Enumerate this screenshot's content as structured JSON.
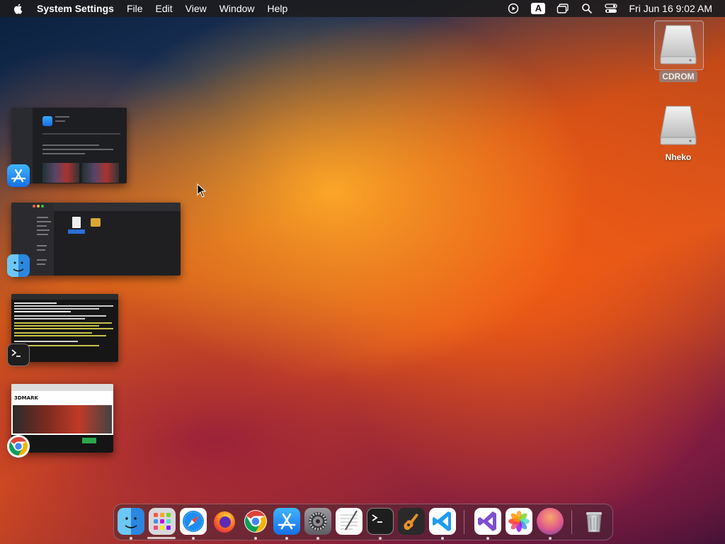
{
  "menubar": {
    "app_name": "System Settings",
    "menus": [
      "File",
      "Edit",
      "View",
      "Window",
      "Help"
    ],
    "clock": "Fri Jun 16  9:02 AM",
    "input_badge": "A"
  },
  "desktop": {
    "icons": [
      {
        "label": "CDROM",
        "selected": true
      },
      {
        "label": "Nheko",
        "selected": false
      }
    ]
  },
  "expose": {
    "windows": [
      {
        "app": "App Store",
        "icon": "app-store-icon"
      },
      {
        "app": "Finder",
        "icon": "finder-icon"
      },
      {
        "app": "Terminal",
        "icon": "terminal-icon"
      },
      {
        "app": "Google Chrome",
        "icon": "chrome-icon",
        "page_logo": "3DMARK"
      }
    ]
  },
  "dock": {
    "apps": [
      {
        "name": "Finder",
        "icon": "finder-icon",
        "running": true
      },
      {
        "name": "Launchpad",
        "icon": "launchpad-icon",
        "running": false
      },
      {
        "name": "Safari",
        "icon": "safari-icon",
        "running": true
      },
      {
        "name": "Firefox",
        "icon": "firefox-icon",
        "running": false
      },
      {
        "name": "Google Chrome",
        "icon": "chrome-icon",
        "running": true
      },
      {
        "name": "App Store",
        "icon": "app-store-icon",
        "running": true
      },
      {
        "name": "System Settings",
        "icon": "system-settings-icon",
        "running": true
      },
      {
        "name": "TextEdit",
        "icon": "textedit-icon",
        "running": false
      },
      {
        "name": "Terminal",
        "icon": "terminal-icon",
        "running": true
      },
      {
        "name": "GarageBand",
        "icon": "garageband-icon",
        "running": false
      },
      {
        "name": "Visual Studio Code",
        "icon": "vscode-icon",
        "running": true
      },
      {
        "name": "Visual Studio",
        "icon": "visual-studio-icon",
        "running": true
      },
      {
        "name": "Photos",
        "icon": "photos-icon",
        "running": false
      },
      {
        "name": "macOS Ventura",
        "icon": "ventura-icon",
        "running": true
      },
      {
        "name": "Trash",
        "icon": "trash-icon",
        "running": false
      }
    ]
  },
  "colors": {
    "menubar_bg": "#1c1c1e",
    "selection_blue": "#2a6fd6"
  }
}
